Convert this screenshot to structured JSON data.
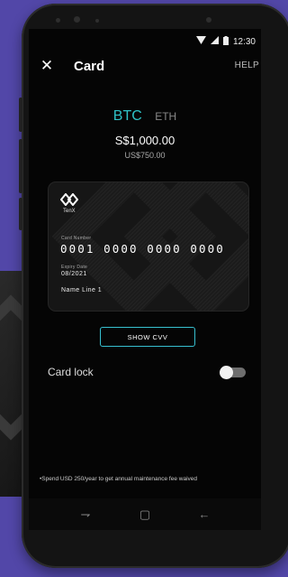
{
  "status": {
    "time": "12:30"
  },
  "appbar": {
    "title": "Card",
    "help": "HELP"
  },
  "coins": [
    {
      "label": "BTC",
      "active": true
    },
    {
      "label": "ETH",
      "active": false
    }
  ],
  "balance": {
    "primary": "S$1,000.00",
    "secondary": "US$750.00"
  },
  "card": {
    "brand": "TenX",
    "number_label": "Card Number",
    "number": "0001 0000 0000 0000",
    "expiry_label": "Expiry Date",
    "expiry": "08/2021",
    "name": "Name Line 1"
  },
  "show_cvv_label": "SHOW CVV",
  "card_lock": {
    "label": "Card lock",
    "enabled": false
  },
  "footnote": "•Spend USD 250/year to get annual maintenance fee waived",
  "accent_color": "#2fc3c7",
  "background_color": "#5247a8"
}
